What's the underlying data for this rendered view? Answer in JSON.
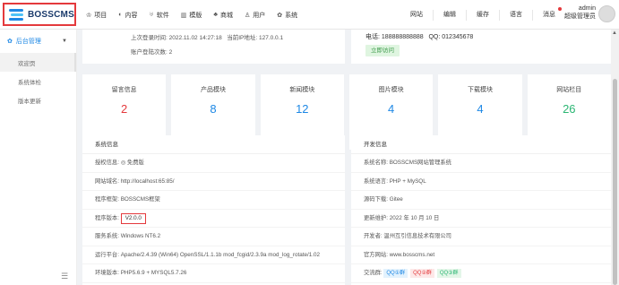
{
  "brand": {
    "name": "BOSSCMS",
    "accent": "#e4393c",
    "blue": "#1e88e5"
  },
  "nav": [
    {
      "icon": "♔",
      "label": "项目"
    },
    {
      "icon": "◐",
      "label": "内容"
    },
    {
      "icon": "♅",
      "label": "软件"
    },
    {
      "icon": "▥",
      "label": "模版"
    },
    {
      "icon": "♣",
      "label": "商城"
    },
    {
      "icon": "♙",
      "label": "用户"
    },
    {
      "icon": "✿",
      "label": "系统"
    }
  ],
  "right_nav": [
    "网站",
    "编辑",
    "缓存",
    "语言",
    "消息"
  ],
  "user": {
    "name": "admin",
    "role": "超级管理员"
  },
  "sidebar": {
    "head": "后台管理",
    "items": [
      "欢迎页",
      "系统体检",
      "版本更新"
    ]
  },
  "login": {
    "time_label": "上次登录时间:",
    "time": "2022.11.02 14:27:18",
    "ip_label": "当前IP地址:",
    "ip": "127.0.0.1",
    "count_label": "账户登陆次数:",
    "count": "2"
  },
  "contact": {
    "phone_label": "电话:",
    "phone": "188888888888",
    "qq_label": "QQ:",
    "qq": "012345678",
    "visit": "立即访问"
  },
  "stats": [
    {
      "label": "留言信息",
      "value": "2",
      "color": "#e4393c"
    },
    {
      "label": "产品模块",
      "value": "8",
      "color": "#1e88e5"
    },
    {
      "label": "新闻模块",
      "value": "12",
      "color": "#1e88e5"
    },
    {
      "label": "图片模块",
      "value": "4",
      "color": "#1e88e5"
    },
    {
      "label": "下载模块",
      "value": "4",
      "color": "#1e88e5"
    },
    {
      "label": "网站栏目",
      "value": "26",
      "color": "#2bb673"
    }
  ],
  "system_info": {
    "title": "系统信息",
    "rows": [
      {
        "k": "授权信息:",
        "v": "◎ 免费版"
      },
      {
        "k": "网站域名:",
        "v": "http://localhost:65:85/"
      },
      {
        "k": "程序框架:",
        "v": "BOSSCMS框架"
      },
      {
        "k": "程序版本:",
        "v": "V2.0.0"
      },
      {
        "k": "服务系统:",
        "v": "Windows NT6.2"
      },
      {
        "k": "运行平台:",
        "v": "Apache/2.4.39 (Win64) OpenSSL/1.1.1b mod_fcgid/2.3.9a mod_log_rotate/1.02"
      },
      {
        "k": "环境版本:",
        "v": "PHP5.6.9 + MYSQL5.7.26"
      }
    ]
  },
  "dev_info": {
    "title": "开发信息",
    "rows": [
      {
        "k": "系统名称:",
        "v": "BOSSCMS网站管理系统"
      },
      {
        "k": "系统语言:",
        "v": "PHP + MySQL"
      },
      {
        "k": "源码下载:",
        "v": "Gitee"
      },
      {
        "k": "更新维护:",
        "v": "2022 年 10 月 10 日"
      },
      {
        "k": "开发者:",
        "v": "温州互引信息技术有限公司"
      },
      {
        "k": "官方网站:",
        "v": "www.bosscms.net"
      },
      {
        "k": "交流群:",
        "v": ""
      }
    ],
    "groups": [
      "QQ①群",
      "QQ②群",
      "QQ③群"
    ]
  }
}
